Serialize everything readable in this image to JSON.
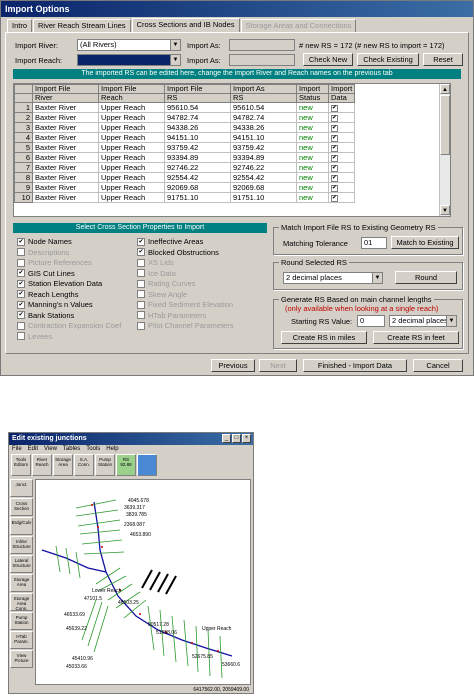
{
  "dialog": {
    "title": "Import Options",
    "tabs": [
      {
        "label": "Intro",
        "state": "normal"
      },
      {
        "label": "River Reach Stream Lines",
        "state": "normal"
      },
      {
        "label": "Cross Sections and IB Nodes",
        "state": "active"
      },
      {
        "label": "Storage Areas and Connections",
        "state": "disabled"
      }
    ],
    "import_river_label": "Import River:",
    "import_river_value": "(All Rivers)",
    "import_reach_label": "Import Reach:",
    "import_reach_value": "",
    "import_as_label": "Import As:",
    "import_as_label2": "Import As:",
    "rs_count_text": "# new RS = 172 (# new RS to import = 172)",
    "check_new": "Check New",
    "check_existing": "Check Existing",
    "reset": "Reset",
    "banner": "The imported RS can be edited here, change the import River and Reach names on the previous tab",
    "grid": {
      "header1": [
        "Import File",
        "Import File",
        "Import File",
        "Import As",
        "Import",
        "Import"
      ],
      "header2": [
        "River",
        "Reach",
        "RS",
        "RS",
        "Status",
        "Data"
      ],
      "rows": [
        {
          "n": "1",
          "river": "Baxter River",
          "reach": "Upper Reach",
          "rs": "95610.54",
          "as": "95610.54",
          "status": "new"
        },
        {
          "n": "2",
          "river": "Baxter River",
          "reach": "Upper Reach",
          "rs": "94782.74",
          "as": "94782.74",
          "status": "new"
        },
        {
          "n": "3",
          "river": "Baxter River",
          "reach": "Upper Reach",
          "rs": "94338.26",
          "as": "94338.26",
          "status": "new"
        },
        {
          "n": "4",
          "river": "Baxter River",
          "reach": "Upper Reach",
          "rs": "94151.10",
          "as": "94151.10",
          "status": "new"
        },
        {
          "n": "5",
          "river": "Baxter River",
          "reach": "Upper Reach",
          "rs": "93759.42",
          "as": "93759.42",
          "status": "new"
        },
        {
          "n": "6",
          "river": "Baxter River",
          "reach": "Upper Reach",
          "rs": "93394.89",
          "as": "93394.89",
          "status": "new"
        },
        {
          "n": "7",
          "river": "Baxter River",
          "reach": "Upper Reach",
          "rs": "92746.22",
          "as": "92746.22",
          "status": "new"
        },
        {
          "n": "8",
          "river": "Baxter River",
          "reach": "Upper Reach",
          "rs": "92554.42",
          "as": "92554.42",
          "status": "new"
        },
        {
          "n": "9",
          "river": "Baxter River",
          "reach": "Upper Reach",
          "rs": "92069.68",
          "as": "92069.68",
          "status": "new"
        },
        {
          "n": "10",
          "river": "Baxter River",
          "reach": "Upper Reach",
          "rs": "91751.10",
          "as": "91751.10",
          "status": "new"
        }
      ]
    },
    "props_banner": "Select Cross Section Properties to Import",
    "props_left": [
      {
        "label": "Node Names",
        "checked": true,
        "enabled": true
      },
      {
        "label": "Descriptions",
        "checked": false,
        "enabled": false
      },
      {
        "label": "Picture References",
        "checked": false,
        "enabled": false
      },
      {
        "label": "GIS Cut Lines",
        "checked": true,
        "enabled": true
      },
      {
        "label": "Station Elevation Data",
        "checked": true,
        "enabled": true
      },
      {
        "label": "Reach Lengths",
        "checked": true,
        "enabled": true
      },
      {
        "label": "Manning's n Values",
        "checked": true,
        "enabled": true
      },
      {
        "label": "Bank Stations",
        "checked": true,
        "enabled": true
      },
      {
        "label": "Contraction Expansion Coef",
        "checked": false,
        "enabled": false
      },
      {
        "label": "Levees",
        "checked": false,
        "enabled": false
      }
    ],
    "props_right": [
      {
        "label": "Ineffective Areas",
        "checked": true,
        "enabled": true
      },
      {
        "label": "Blocked Obstructions",
        "checked": true,
        "enabled": true
      },
      {
        "label": "XS Lids",
        "checked": false,
        "enabled": false
      },
      {
        "label": "Ice Data",
        "checked": false,
        "enabled": false
      },
      {
        "label": "Rating Curves",
        "checked": false,
        "enabled": false
      },
      {
        "label": "Skew Angle",
        "checked": false,
        "enabled": false
      },
      {
        "label": "Fixed Sediment Elevation",
        "checked": false,
        "enabled": false
      },
      {
        "label": "HTab Parameters",
        "checked": false,
        "enabled": false
      },
      {
        "label": "Pilot Channel Parameters",
        "checked": false,
        "enabled": false
      }
    ],
    "match_group": "Match Import File RS to Existing Geometry RS",
    "matching_tolerance_label": "Matching Tolerance",
    "matching_tolerance_value": "01",
    "match_btn": "Match to Existing",
    "round_group": "Round Selected RS",
    "round_select": "2 decimal places",
    "round_btn": "Round",
    "generate_group": "Generate RS Based on main channel lengths",
    "generate_note": "(only available when looking at a single reach)",
    "starting_rs_label": "Starting RS  Value:",
    "starting_rs_value": "0",
    "starting_rs_select": "2 decimal places",
    "create_miles": "Create RS in miles",
    "create_feet": "Create RS in feet",
    "previous": "Previous",
    "next": "Next",
    "finished": "Finished - Import Data",
    "cancel": "Cancel"
  },
  "junctions": {
    "title": "Edit existing junctions",
    "menu": [
      "File",
      "Edit",
      "View",
      "Tables",
      "Tools",
      "Help"
    ],
    "toolbar": [
      "Tools Editors",
      "River Reach",
      "Storage Area",
      "S.A. Conn.",
      "Pump Station",
      "RS 92.88",
      ""
    ],
    "side": [
      "Junct.",
      "Cross Section",
      "Brdg/Culv",
      "Inline Structure",
      "Lateral Structure",
      "Storage Area",
      "Storage Area Conn.",
      "Pump Station",
      "HTab Param.",
      "View Picture"
    ],
    "labels": [
      "4045.678",
      "3639.317",
      "3839.785",
      "2368.087",
      "4653.890",
      "Lower Reach",
      "47101.5",
      "46533.69",
      "45639.22",
      "45410.96",
      "45033.66",
      "50517.28",
      "51658.06",
      "52675.85",
      "53660.6",
      "Upper Reach",
      "46503.25"
    ],
    "status": "6417562.00, 2059409.00"
  }
}
